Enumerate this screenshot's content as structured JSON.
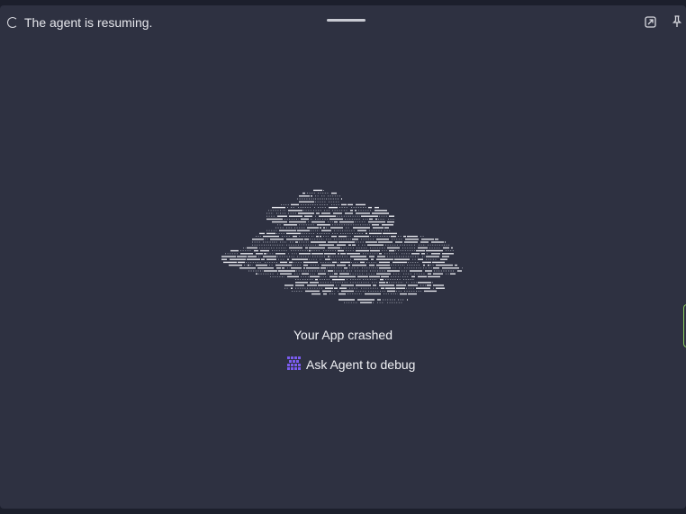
{
  "status": {
    "text": "The agent is resuming."
  },
  "header": {
    "icons": [
      "open-in-new-tab-icon",
      "pin-icon"
    ]
  },
  "crash": {
    "message": "Your App crashed",
    "debug_button_label": "Ask Agent to debug"
  },
  "colors": {
    "background": "#2e3141",
    "text": "#eff0f4",
    "accent": "#7b5cf0",
    "side_tab": "#8fce62"
  }
}
